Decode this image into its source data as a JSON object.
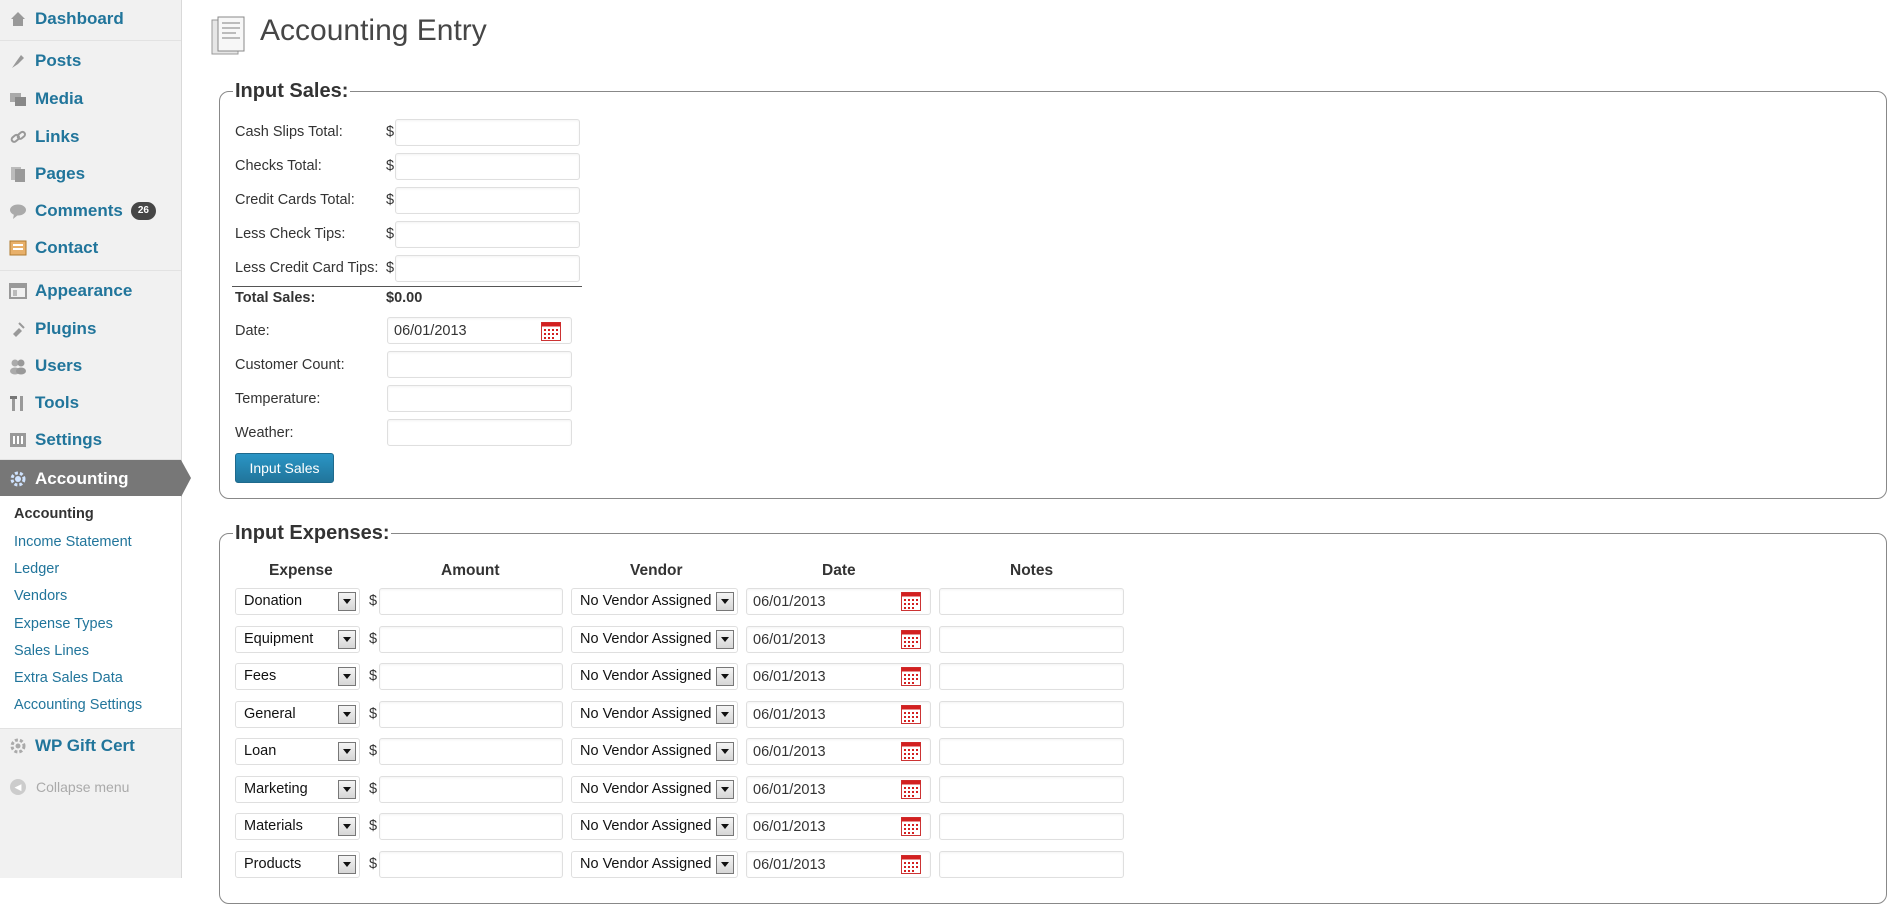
{
  "sidebar": {
    "menu": [
      {
        "label": "Dashboard",
        "icon": "dashboard-icon"
      },
      {
        "label": "Posts",
        "icon": "posts-icon"
      },
      {
        "label": "Media",
        "icon": "media-icon"
      },
      {
        "label": "Links",
        "icon": "links-icon"
      },
      {
        "label": "Pages",
        "icon": "pages-icon"
      },
      {
        "label": "Comments",
        "icon": "comments-icon",
        "badge": "26"
      },
      {
        "label": "Contact",
        "icon": "contact-icon"
      },
      {
        "label": "Appearance",
        "icon": "appearance-icon"
      },
      {
        "label": "Plugins",
        "icon": "plugins-icon"
      },
      {
        "label": "Users",
        "icon": "users-icon"
      },
      {
        "label": "Tools",
        "icon": "tools-icon"
      },
      {
        "label": "Settings",
        "icon": "settings-icon"
      },
      {
        "label": "Accounting",
        "icon": "gear-icon",
        "active": true
      }
    ],
    "submenu": [
      {
        "label": "Accounting",
        "current": true
      },
      {
        "label": "Income Statement"
      },
      {
        "label": "Ledger"
      },
      {
        "label": "Vendors"
      },
      {
        "label": "Expense Types"
      },
      {
        "label": "Sales Lines"
      },
      {
        "label": "Extra Sales Data"
      },
      {
        "label": "Accounting Settings"
      }
    ],
    "extra_item": {
      "label": "WP Gift Cert",
      "icon": "gift-cert-icon"
    },
    "collapse_label": "Collapse menu"
  },
  "page": {
    "title": "Accounting Entry",
    "icon": "accounting-page-icon"
  },
  "sales": {
    "legend": "Input Sales:",
    "currency_symbol": "$",
    "money_fields": [
      {
        "label": "Cash Slips Total:",
        "value": ""
      },
      {
        "label": "Checks Total:",
        "value": ""
      },
      {
        "label": "Credit Cards Total:",
        "value": ""
      },
      {
        "label": "Less Check Tips:",
        "value": ""
      },
      {
        "label": "Less Credit Card Tips:",
        "value": ""
      }
    ],
    "total_label": "Total Sales:",
    "total_value": "$0.00",
    "date_label": "Date:",
    "date_value": "06/01/2013",
    "customer_count_label": "Customer Count:",
    "customer_count_value": "",
    "temperature_label": "Temperature:",
    "temperature_value": "",
    "weather_label": "Weather:",
    "weather_value": "",
    "submit_label": "Input Sales"
  },
  "expenses": {
    "legend": "Input Expenses:",
    "currency_symbol": "$",
    "headers": {
      "expense": "Expense",
      "amount": "Amount",
      "vendor": "Vendor",
      "date": "Date",
      "notes": "Notes"
    },
    "rows": [
      {
        "expense": "Donation",
        "amount": "",
        "vendor": "No Vendor Assigned",
        "date": "06/01/2013",
        "notes": ""
      },
      {
        "expense": "Equipment",
        "amount": "",
        "vendor": "No Vendor Assigned",
        "date": "06/01/2013",
        "notes": ""
      },
      {
        "expense": "Fees",
        "amount": "",
        "vendor": "No Vendor Assigned",
        "date": "06/01/2013",
        "notes": ""
      },
      {
        "expense": "General",
        "amount": "",
        "vendor": "No Vendor Assigned",
        "date": "06/01/2013",
        "notes": ""
      },
      {
        "expense": "Loan",
        "amount": "",
        "vendor": "No Vendor Assigned",
        "date": "06/01/2013",
        "notes": ""
      },
      {
        "expense": "Marketing",
        "amount": "",
        "vendor": "No Vendor Assigned",
        "date": "06/01/2013",
        "notes": ""
      },
      {
        "expense": "Materials",
        "amount": "",
        "vendor": "No Vendor Assigned",
        "date": "06/01/2013",
        "notes": ""
      },
      {
        "expense": "Products",
        "amount": "",
        "vendor": "No Vendor Assigned",
        "date": "06/01/2013",
        "notes": ""
      }
    ]
  },
  "colors": {
    "link": "#21759b",
    "active_menu_bg": "#777777",
    "button": "#21759b",
    "badge_bg": "#464646",
    "calendar_red": "#d32020"
  }
}
